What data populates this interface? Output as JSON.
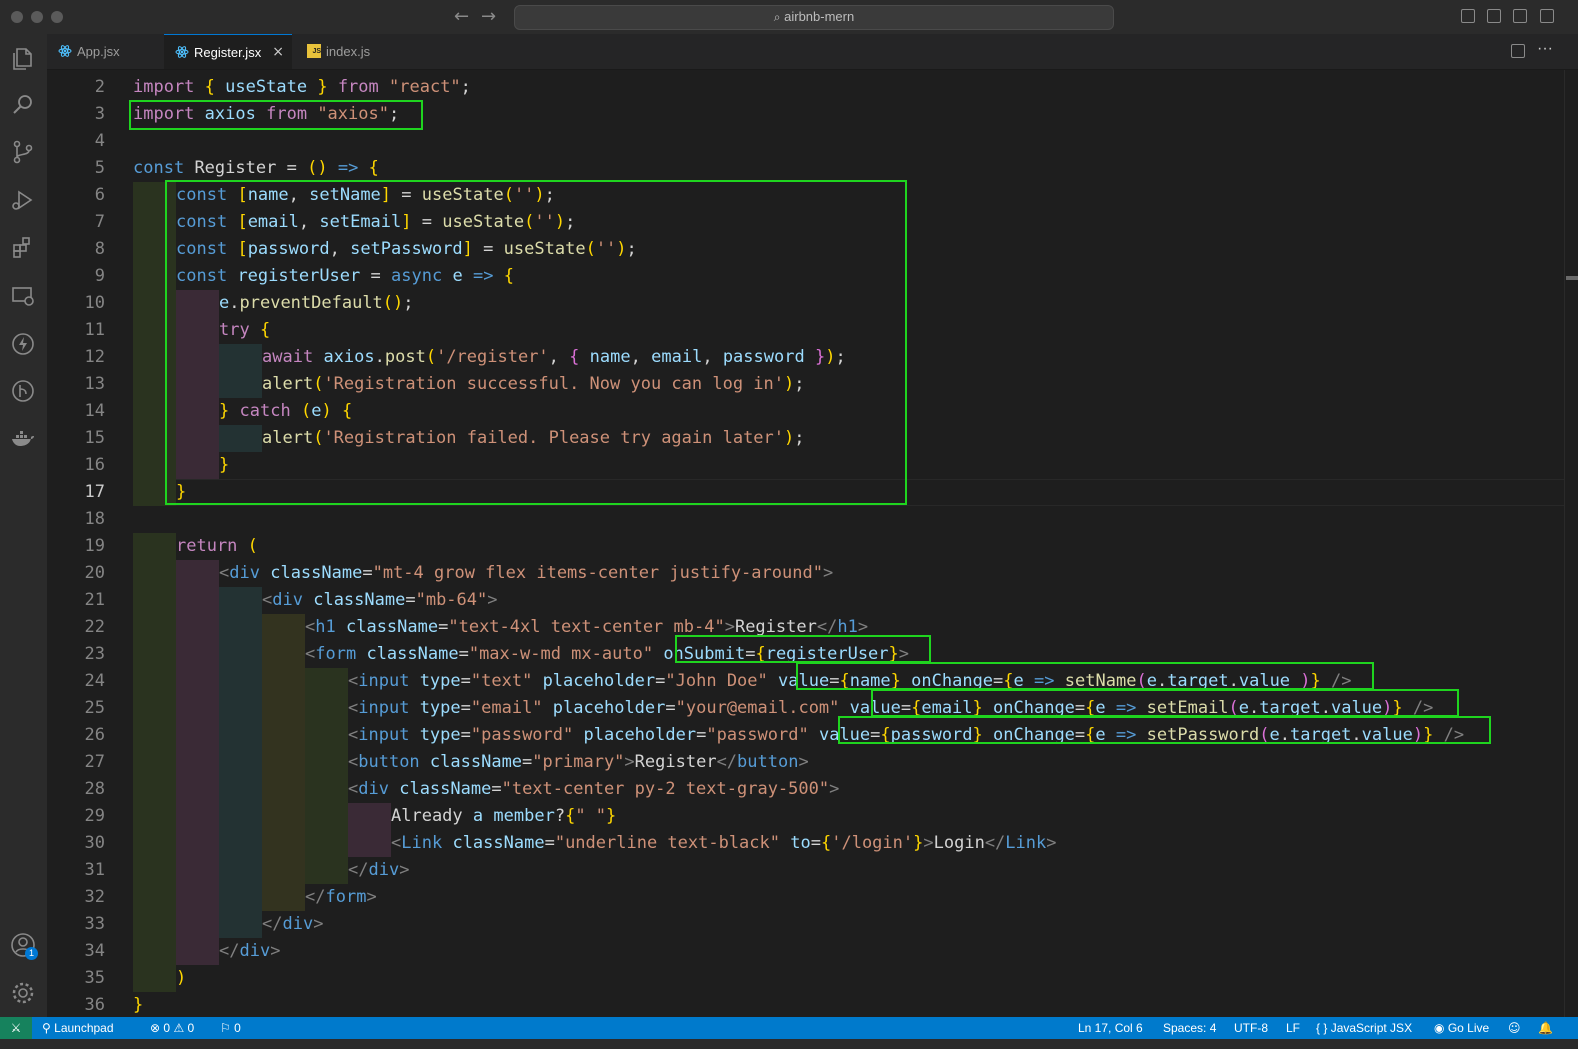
{
  "window": {
    "title": "airbnb-mern"
  },
  "tabs": [
    {
      "label": "App.jsx"
    },
    {
      "label": "Register.jsx",
      "close": "×"
    },
    {
      "label": "index.js",
      "badge": "JS"
    }
  ],
  "editor": {
    "line_numbers": [
      "2",
      "3",
      "4",
      "5",
      "6",
      "7",
      "8",
      "9",
      "10",
      "11",
      "12",
      "13",
      "14",
      "15",
      "16",
      "17",
      "18",
      "19",
      "20",
      "21",
      "22",
      "23",
      "24",
      "25",
      "26",
      "27",
      "28",
      "29",
      "30",
      "31",
      "32",
      "33",
      "34",
      "35",
      "36"
    ],
    "current_line": "17",
    "code_lines": [
      "import { useState } from \"react\";",
      "import axios from \"axios\";",
      "",
      "const Register = () => {",
      "  const [name, setName] = useState('');",
      "  const [email, setEmail] = useState('');",
      "  const [password, setPassword] = useState('');",
      "  const registerUser = async e => {",
      "    e.preventDefault();",
      "    try {",
      "      await axios.post('/register', { name, email, password });",
      "      alert('Registration successful. Now you can log in');",
      "    } catch (e) {",
      "      alert('Registration failed. Please try again later');",
      "    }",
      "  }",
      "",
      "  return (",
      "    <div className=\"mt-4 grow flex items-center justify-around\">",
      "      <div className=\"mb-64\">",
      "        <h1 className=\"text-4xl text-center mb-4\">Register</h1>",
      "        <form className=\"max-w-md mx-auto\" onSubmit={registerUser}>",
      "          <input type=\"text\" placeholder=\"John Doe\" value={name} onChange={e => setName(e.target.value )} />",
      "          <input type=\"email\" placeholder=\"your@email.com\" value={email} onChange={e => setEmail(e.target.value)} />",
      "          <input type=\"password\" placeholder=\"password\" value={password} onChange={e => setPassword(e.target.value)} />",
      "          <button className=\"primary\">Register</button>",
      "          <div className=\"text-center py-2 text-gray-500\">",
      "            Already a member?{\" \"}",
      "            <Link className=\"underline text-black\" to={'/login'}>Login</Link>",
      "          </div>",
      "        </form>",
      "      </div>",
      "    </div>",
      "  )",
      "}"
    ]
  },
  "statusbar": {
    "remote": "⚔",
    "launchpad": "Launchpad",
    "errors": "0",
    "warnings": "0",
    "ports": "0",
    "position": "Ln 17, Col 6",
    "spaces": "Spaces: 4",
    "encoding": "UTF-8",
    "eol": "LF",
    "language": "JavaScript JSX",
    "golive": "Go Live"
  },
  "activity": {
    "accounts_badge": "1"
  },
  "icons": [
    "files-icon",
    "search-icon",
    "source-control-icon",
    "run-debug-icon",
    "extensions-icon",
    "remote-explorer-icon",
    "thunder-client-icon",
    "git-graph-icon",
    "docker-icon",
    "accounts-icon",
    "settings-gear-icon"
  ],
  "colors": {
    "highlight": "#1fd41f",
    "statusbar": "#007acc",
    "remote": "#16825d"
  }
}
